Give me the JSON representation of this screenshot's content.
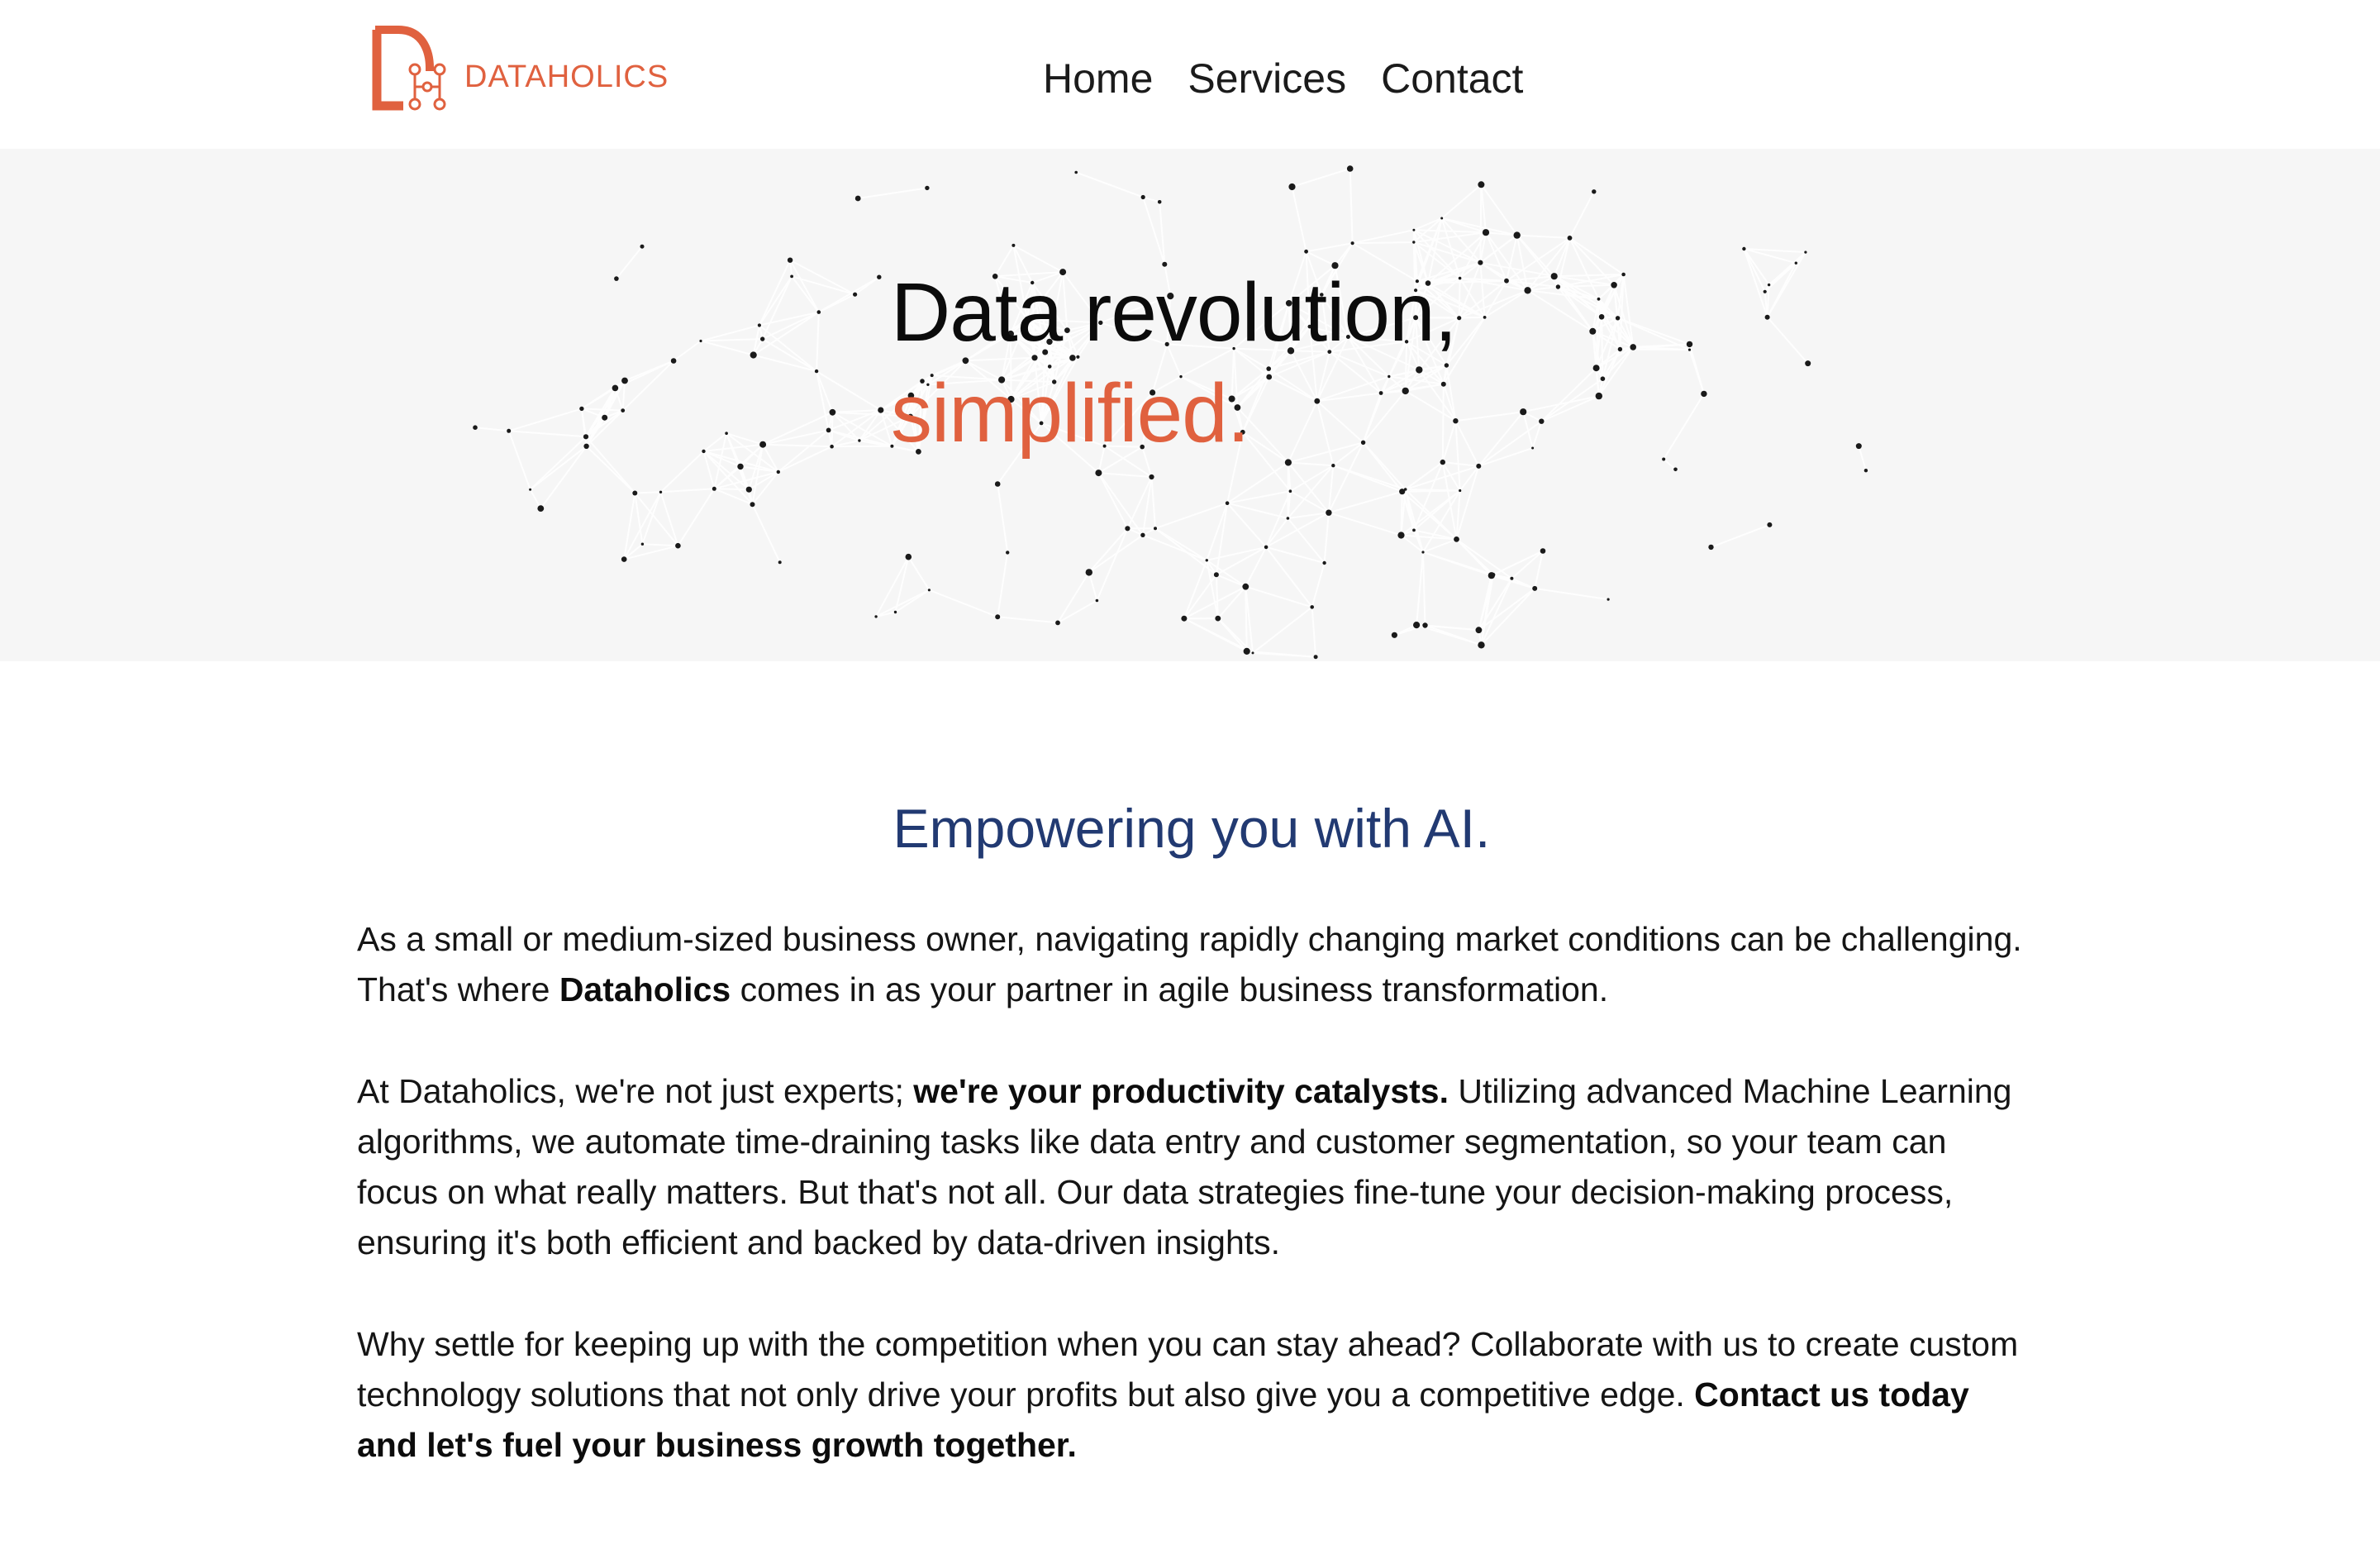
{
  "header": {
    "logo_text": "DATAHOLICS",
    "nav": [
      "Home",
      "Services",
      "Contact"
    ]
  },
  "hero": {
    "title_line1": "Data revolution,",
    "title_line2": "simplified."
  },
  "main": {
    "heading": "Empowering you with AI.",
    "p1": {
      "a": "As a small or medium-sized business owner, navigating rapidly changing market conditions can be challenging. That's where ",
      "b": "Dataholics",
      "c": " comes in as your partner in agile business transformation."
    },
    "p2": {
      "a": "At Dataholics, we're not just experts; ",
      "b": "we're your productivity catalysts.",
      "c": " Utilizing advanced Machine Learning algorithms, we automate time-draining tasks like data entry and customer segmentation, so your team can focus on what really matters. But that's not all. Our data strategies fine-tune your decision-making process, ensuring it's both efficient and backed by data-driven insights."
    },
    "p3": {
      "a": "Why settle for keeping up with the competition when you can stay ahead? Collaborate with us to create custom technology solutions that not only drive your profits but also give you a competitive edge. ",
      "b": "Contact us today and let's fuel your business growth together."
    }
  },
  "colors": {
    "brand": "#e0613f",
    "heading": "#223a72",
    "hero_bg": "#f6f6f6"
  },
  "icons": [
    "dataholics-logo-icon",
    "network-dots-graphic"
  ]
}
